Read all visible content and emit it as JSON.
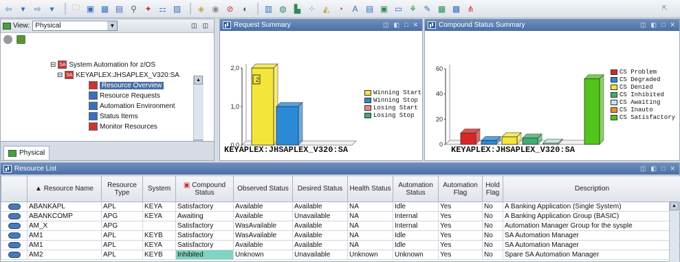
{
  "view": {
    "label": "View:",
    "selected": "Physical",
    "tab_label": "Physical"
  },
  "tree": [
    {
      "label": "System Automation for z/OS",
      "indent": 0
    },
    {
      "label": "KEYAPLEX:JHSAPLEX_V320:SA",
      "indent": 1
    },
    {
      "label": "Resource Overview",
      "indent": 2,
      "selected": true
    },
    {
      "label": "Resource Requests",
      "indent": 2
    },
    {
      "label": "Automation Environment",
      "indent": 2
    },
    {
      "label": "Status Items",
      "indent": 2
    },
    {
      "label": "Monitor Resources",
      "indent": 2
    }
  ],
  "request_summary": {
    "panel_title": "Request Summary",
    "footer": "KEYAPLEX:JHSAPLEX_V320:SA",
    "chart_data": {
      "type": "bar",
      "ylim": [
        0,
        2
      ],
      "yticks": [
        "2,0",
        "1,0",
        "0,0"
      ],
      "series": [
        {
          "name": "Winning Start",
          "value": 2,
          "color": "#f4e53a"
        },
        {
          "name": "Winning Stop",
          "value": 1,
          "color": "#2b8ad6"
        },
        {
          "name": "Losing Start",
          "value": 0,
          "color": "#e48a8a"
        },
        {
          "name": "Losing Stop",
          "value": 0,
          "color": "#3fae6e"
        }
      ],
      "data_label": "2"
    }
  },
  "compound_summary": {
    "panel_title": "Compound Status Summary",
    "footer": "KEYAPLEX:JHSAPLEX_V320:SA",
    "chart_data": {
      "type": "bar",
      "ylim": [
        0,
        60
      ],
      "yticks": [
        "60",
        "40",
        "20",
        "0"
      ],
      "series": [
        {
          "name": "CS Problem",
          "value": 9,
          "color": "#d62828"
        },
        {
          "name": "CS Degraded",
          "value": 3,
          "color": "#2b8ad6"
        },
        {
          "name": "CS Denied",
          "value": 6,
          "color": "#f4e53a"
        },
        {
          "name": "CS Inhibited",
          "value": 5,
          "color": "#3fae6e"
        },
        {
          "name": "CS Awaiting",
          "value": 1,
          "color": "#bde9e0"
        },
        {
          "name": "CS Inauto",
          "value": 0,
          "color": "#f08a2a"
        },
        {
          "name": "CS Satisfactory",
          "value": 52,
          "color": "#52c41a"
        }
      ]
    }
  },
  "resource_list": {
    "panel_title": "Resource List",
    "columns": [
      "",
      "Resource Name",
      "Resource Type",
      "System",
      "Compound Status",
      "Observed Status",
      "Desired Status",
      "Health Status",
      "Automation Status",
      "Automation Flag",
      "Hold Flag",
      "Description"
    ],
    "rows": [
      [
        "ABANKAPL",
        "APL",
        "KEYA",
        "Satisfactory",
        "Available",
        "Available",
        "NA",
        "Idle",
        "Yes",
        "No",
        "A Banking Application (Single System)"
      ],
      [
        "ABANKCOMP",
        "APG",
        "KEYA",
        "Awaiting",
        "Available",
        "Unavailable",
        "NA",
        "Internal",
        "Yes",
        "No",
        "A Banking Application Group (BASIC)"
      ],
      [
        "AM_X",
        "APG",
        "",
        "Satisfactory",
        "WasAvailable",
        "Available",
        "NA",
        "Internal",
        "Yes",
        "No",
        "Automation Manager Group for the sysple"
      ],
      [
        "AM1",
        "APL",
        "KEYB",
        "Satisfactory",
        "WasAvailable",
        "Available",
        "NA",
        "Idle",
        "Yes",
        "No",
        "SA Automation Manager"
      ],
      [
        "AM1",
        "APL",
        "KEYA",
        "Satisfactory",
        "Available",
        "Available",
        "NA",
        "Idle",
        "Yes",
        "No",
        "SA Automation Manager"
      ],
      [
        "AM2",
        "APL",
        "KEYB",
        "Inhibited",
        "Unknown",
        "Unavailable",
        "Unknown",
        "Unknown",
        "Yes",
        "No",
        "Spare SA Automation Manager"
      ]
    ]
  },
  "toolbar_icons": [
    "back-icon",
    "menu-arrow-icon",
    "forward-icon",
    "menu-arrow-icon",
    "folder-icon",
    "save-icon",
    "workspace-icon",
    "properties-icon",
    "link-icon",
    "filter-icon",
    "tree-icon",
    "calendar-icon",
    "chart-icon",
    "pie-icon",
    "stop-icon",
    "speaker-icon",
    "table-icon",
    "globe-icon",
    "bar-chart-icon",
    "scatter-icon",
    "area-icon",
    "gauge-icon",
    "text-icon",
    "notepad-icon",
    "terminal-icon",
    "comment-icon",
    "plug-icon",
    "pencil-icon",
    "grid-icon",
    "image-icon",
    "topology-icon"
  ]
}
